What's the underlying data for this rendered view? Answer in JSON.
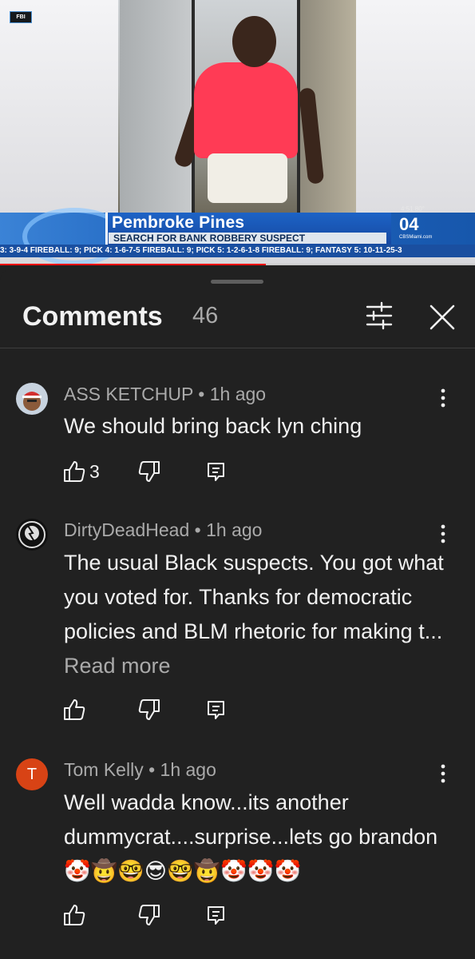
{
  "video": {
    "fbi_label": "FBI",
    "headline": "Pembroke Pines",
    "subheadline": "SEARCH FOR BANK ROBBERY SUSPECT",
    "time_temp": "4:51 80°",
    "channel": "04",
    "site": "CBSMiami.com",
    "ticker": "3: 3-9-4 FIREBALL: 9;  PICK 4: 1-6-7-5 FIREBALL: 9;  PICK 5: 1-2-6-1-8 FIREBALL: 9;  FANTASY 5: 10-11-25-3",
    "progress": 0.56
  },
  "header": {
    "title": "Comments",
    "count": "46"
  },
  "comments": [
    {
      "author": "ASS KETCHUP",
      "time": "1h ago",
      "text": "We should bring back lyn ching",
      "read_more": "",
      "likes": "3",
      "avatar_color": "#b8c5d6"
    },
    {
      "author": "DirtyDeadHead",
      "time": "1h ago",
      "text": "The usual Black suspects. You got what you voted for. Thanks for democratic policies and BLM rhetoric for making t... ",
      "read_more": "Read more",
      "likes": "",
      "avatar_color": "#111111"
    },
    {
      "author": "Tom Kelly",
      "time": "1h ago",
      "text": "Well wadda know...its another dummycrat....surprise...lets go brandon🤡🤠🤓😎🤓🤠🤡🤡🤡",
      "read_more": "",
      "likes": "",
      "avatar_letter": "T",
      "avatar_color": "#d84315"
    }
  ],
  "icons": {
    "filter": "sliders-icon",
    "close": "close-icon",
    "like": "thumbs-up-icon",
    "dislike": "thumbs-down-icon",
    "reply": "reply-icon",
    "more": "vertical-dots-icon"
  }
}
